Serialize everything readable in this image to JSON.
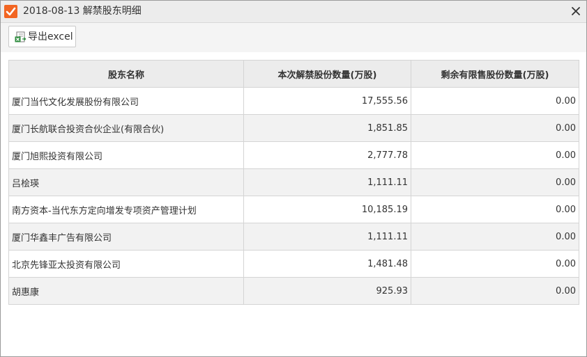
{
  "window": {
    "title": "2018-08-13  解禁股东明细",
    "accent_color": "#f26522",
    "title_icon": "checkbox-checked-icon",
    "close_icon": "close-icon"
  },
  "toolbar": {
    "export_label": "导出excel",
    "export_icon": "excel-export-icon"
  },
  "table": {
    "columns": [
      "股东名称",
      "本次解禁股份数量(万股)",
      "剩余有限售股份数量(万股)"
    ],
    "rows": [
      {
        "name": "厦门当代文化发展股份有限公司",
        "unlocked": "17,555.56",
        "remaining": "0.00"
      },
      {
        "name": "厦门长航联合投资合伙企业(有限合伙)",
        "unlocked": "1,851.85",
        "remaining": "0.00"
      },
      {
        "name": "厦门旭熙投资有限公司",
        "unlocked": "2,777.78",
        "remaining": "0.00"
      },
      {
        "name": "吕桧瑛",
        "unlocked": "1,111.11",
        "remaining": "0.00"
      },
      {
        "name": "南方资本-当代东方定向增发专项资产管理计划",
        "unlocked": "10,185.19",
        "remaining": "0.00"
      },
      {
        "name": "厦门华鑫丰广告有限公司",
        "unlocked": "1,111.11",
        "remaining": "0.00"
      },
      {
        "name": "北京先锋亚太投资有限公司",
        "unlocked": "1,481.48",
        "remaining": "0.00"
      },
      {
        "name": "胡惠康",
        "unlocked": "925.93",
        "remaining": "0.00"
      }
    ]
  }
}
